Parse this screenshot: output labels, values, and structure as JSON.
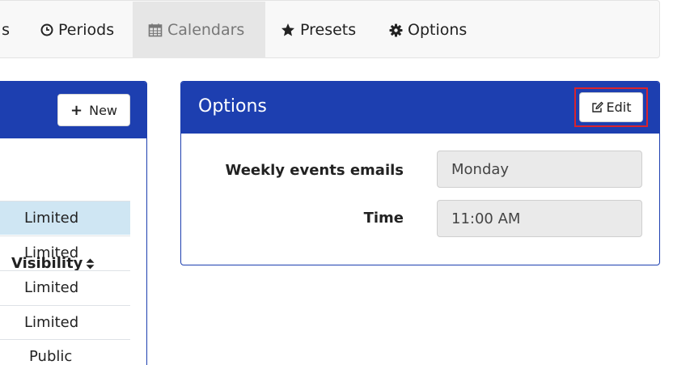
{
  "nav": {
    "cut_label": "s",
    "periods": "Periods",
    "calendars": "Calendars",
    "presets": "Presets",
    "options": "Options"
  },
  "left_panel": {
    "new_button": "New",
    "column_header": "Visibility",
    "rows": [
      "Limited",
      "Limited",
      "Limited",
      "Limited",
      "Public"
    ]
  },
  "options_card": {
    "title": "Options",
    "edit_button": "Edit",
    "fields": [
      {
        "label": "Weekly events emails",
        "value": "Monday"
      },
      {
        "label": "Time",
        "value": "11:00 AM"
      }
    ]
  },
  "colors": {
    "primary": "#1d3fb0",
    "selected_row": "#cfe6f3",
    "highlight_outline": "#d9232d",
    "active_tab": "#e6e6e6"
  },
  "icons": {
    "periods": "clock-icon",
    "calendars": "calendar-icon",
    "presets": "star-icon",
    "options": "gear-icon",
    "new": "plus-icon",
    "sort": "sort-icon",
    "edit": "edit-icon"
  }
}
